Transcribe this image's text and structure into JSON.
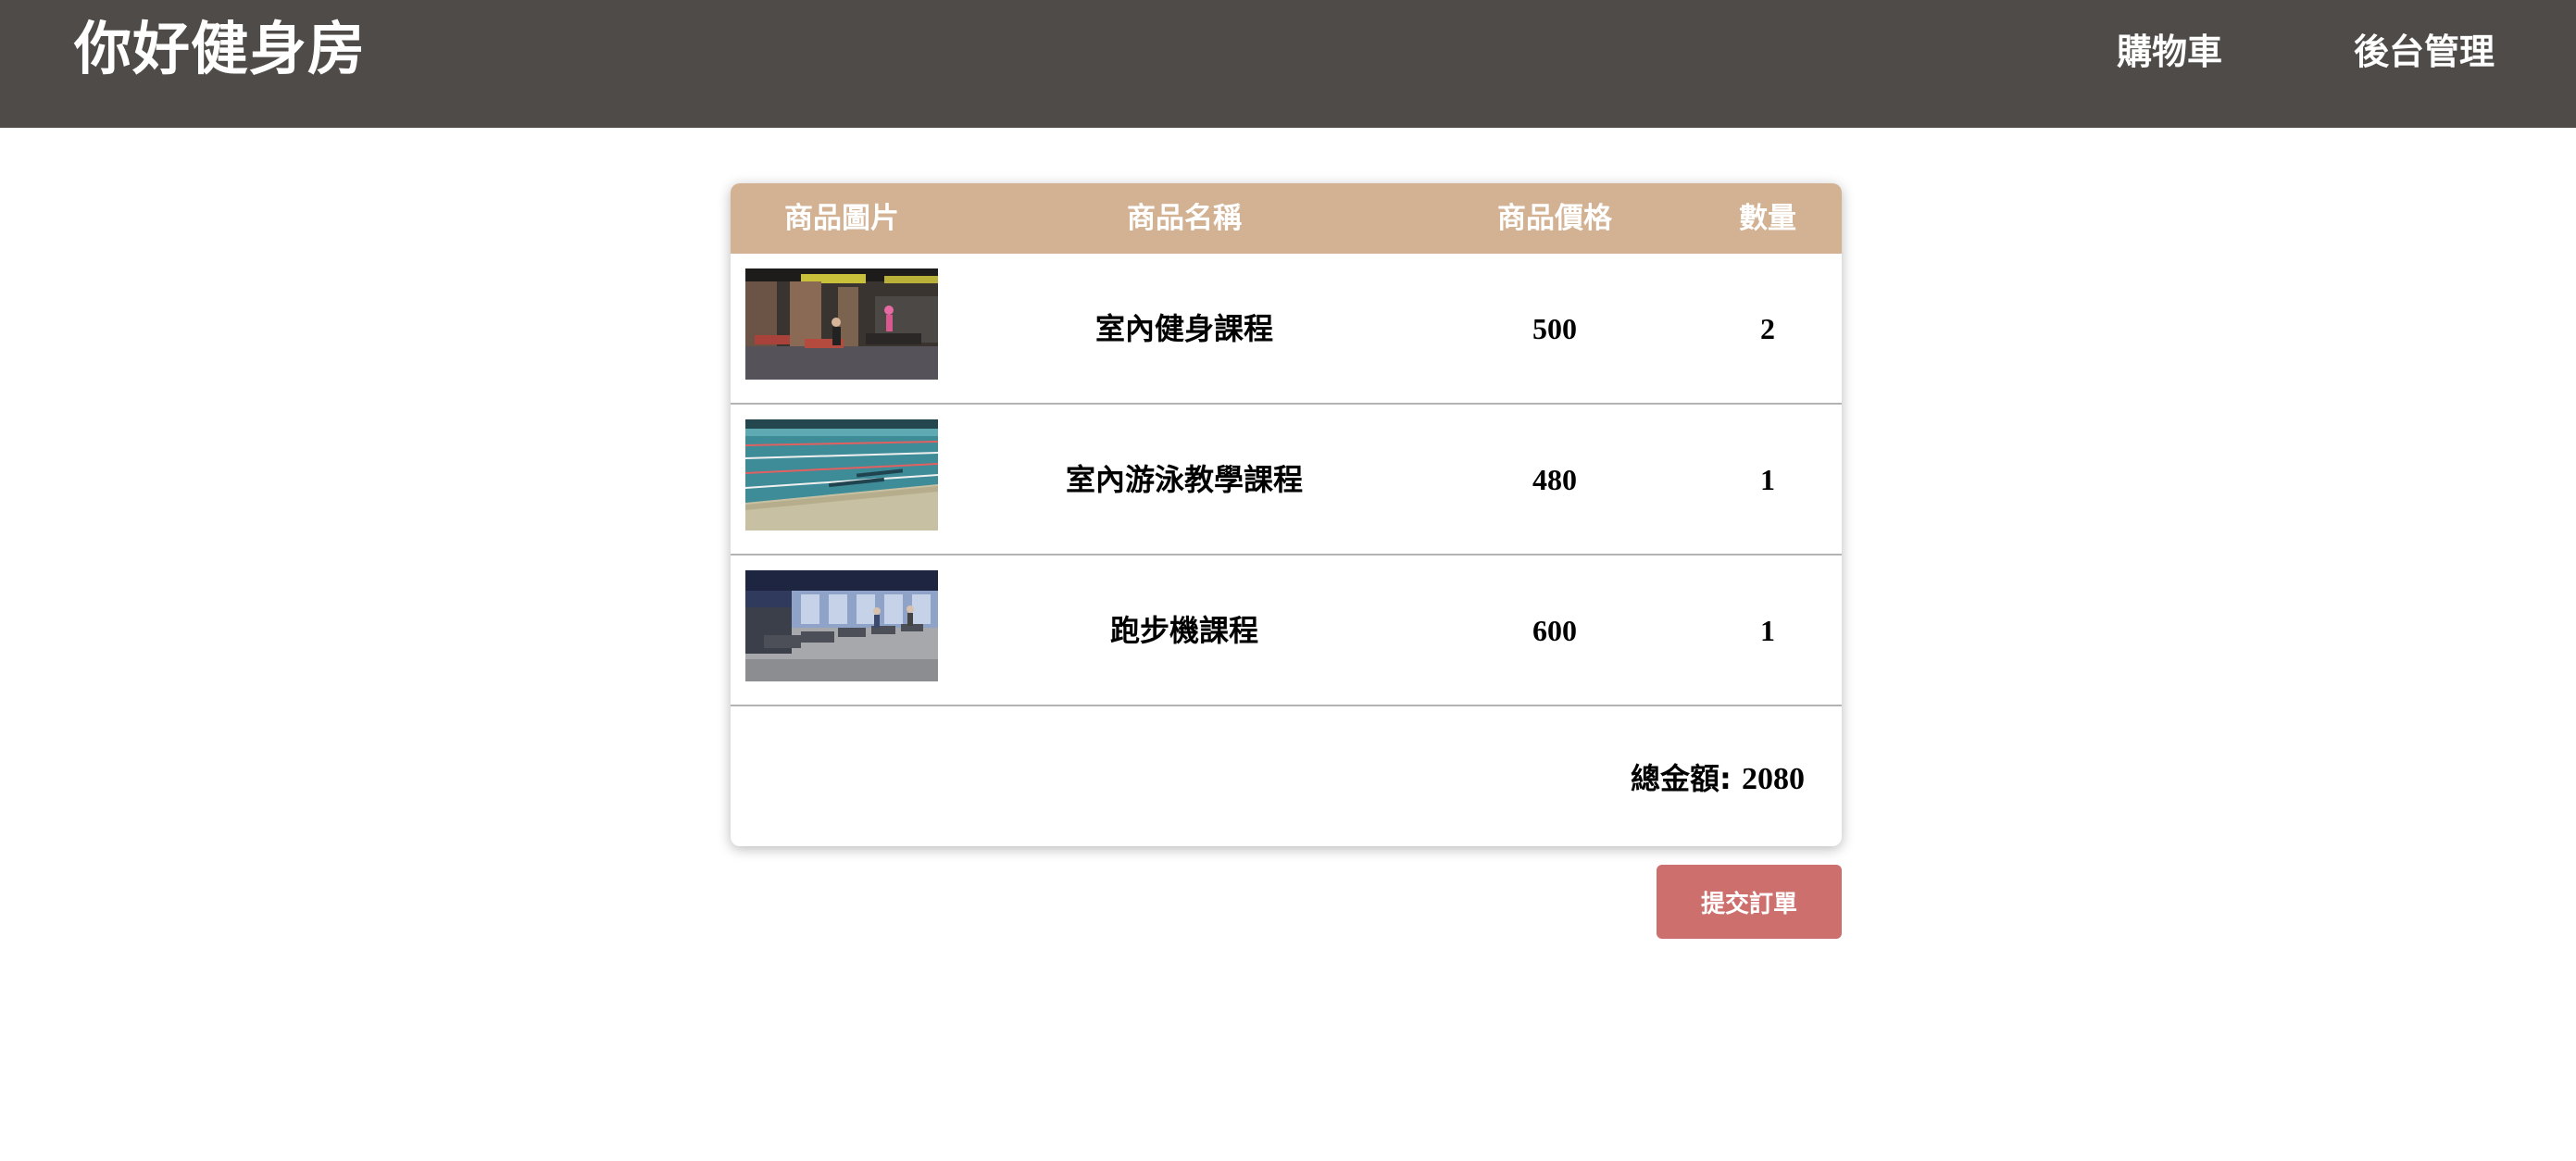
{
  "header": {
    "brand": "你好健身房",
    "nav": {
      "cart": "購物車",
      "admin": "後台管理"
    }
  },
  "cart": {
    "columns": {
      "image": "商品圖片",
      "name": "商品名稱",
      "price": "商品價格",
      "quantity": "數量"
    },
    "items": [
      {
        "image": "indoor-gym-photo",
        "name": "室內健身課程",
        "price": "500",
        "quantity": "2"
      },
      {
        "image": "indoor-pool-photo",
        "name": "室內游泳教學課程",
        "price": "480",
        "quantity": "1"
      },
      {
        "image": "treadmill-room-photo",
        "name": "跑步機課程",
        "price": "600",
        "quantity": "1"
      }
    ],
    "total_label": "總金額:",
    "total_value": "2080"
  },
  "actions": {
    "submit_label": "提交訂單"
  },
  "colors": {
    "header_bg": "#4f4b48",
    "table_header_bg": "#d2b293",
    "submit_bg": "#cd6f6d"
  }
}
